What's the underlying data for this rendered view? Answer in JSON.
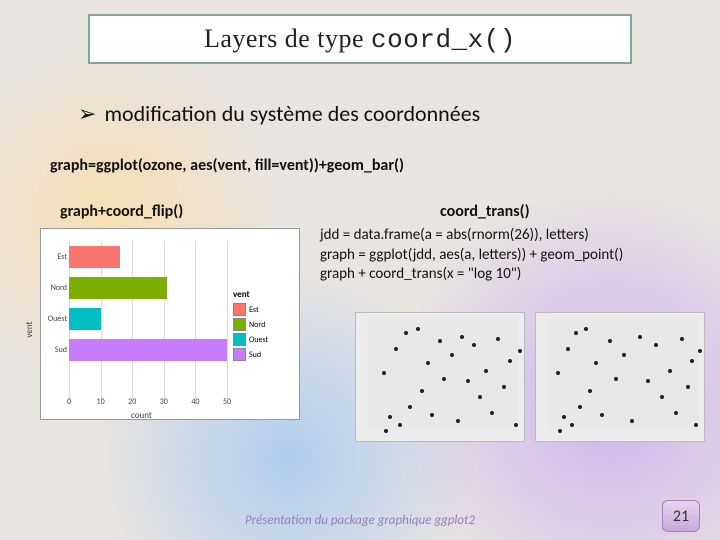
{
  "title": {
    "prefix": "Layers de type ",
    "mono": "coord_x()"
  },
  "bullet": {
    "arrow": "➢",
    "text": "modification du système des coordonnées"
  },
  "code1": "graph=ggplot(ozone, aes(vent, fill=vent))+geom_bar()",
  "leftLabel": "graph+coord_flip()",
  "rightLabel": "coord_trans()",
  "codeBlock": {
    "l1": "jdd = data.frame(a = abs(rnorm(26)), letters)",
    "l2": "graph = ggplot(jdd, aes(a, letters)) + geom_point()",
    "l3": "graph + coord_trans(x = \"log 10\")"
  },
  "chart_data": {
    "type": "bar",
    "orientation": "horizontal",
    "ylabel": "vent",
    "xlabel": "count",
    "categories": [
      "Est",
      "Nord",
      "Ouest",
      "Sud"
    ],
    "values": [
      16,
      31,
      10,
      50
    ],
    "xlim": [
      0,
      50
    ],
    "xticks": [
      0,
      10,
      20,
      30,
      40,
      50
    ],
    "colors": [
      "#f8766d",
      "#7cae00",
      "#00bfc4",
      "#c77cff"
    ],
    "legend_title": "vent"
  },
  "scatter": {
    "pts1": [
      [
        16,
        110
      ],
      [
        20,
        96
      ],
      [
        26,
        28
      ],
      [
        30,
        104
      ],
      [
        36,
        12
      ],
      [
        40,
        86
      ],
      [
        48,
        8
      ],
      [
        52,
        70
      ],
      [
        58,
        42
      ],
      [
        62,
        94
      ],
      [
        70,
        20
      ],
      [
        74,
        58
      ],
      [
        82,
        34
      ],
      [
        88,
        100
      ],
      [
        92,
        16
      ],
      [
        98,
        60
      ],
      [
        104,
        24
      ],
      [
        110,
        76
      ],
      [
        116,
        50
      ],
      [
        122,
        92
      ],
      [
        128,
        18
      ],
      [
        134,
        66
      ],
      [
        140,
        40
      ],
      [
        146,
        104
      ],
      [
        150,
        30
      ],
      [
        14,
        52
      ]
    ],
    "pts2": [
      [
        10,
        110
      ],
      [
        14,
        96
      ],
      [
        18,
        28
      ],
      [
        22,
        104
      ],
      [
        26,
        12
      ],
      [
        30,
        86
      ],
      [
        36,
        8
      ],
      [
        40,
        70
      ],
      [
        46,
        42
      ],
      [
        52,
        94
      ],
      [
        60,
        20
      ],
      [
        66,
        58
      ],
      [
        74,
        34
      ],
      [
        82,
        100
      ],
      [
        90,
        16
      ],
      [
        98,
        60
      ],
      [
        106,
        24
      ],
      [
        112,
        76
      ],
      [
        120,
        50
      ],
      [
        126,
        92
      ],
      [
        132,
        18
      ],
      [
        138,
        66
      ],
      [
        142,
        40
      ],
      [
        146,
        104
      ],
      [
        150,
        30
      ],
      [
        8,
        52
      ]
    ]
  },
  "footer": "Présentation du package graphique ggplot2",
  "pageNum": "21"
}
